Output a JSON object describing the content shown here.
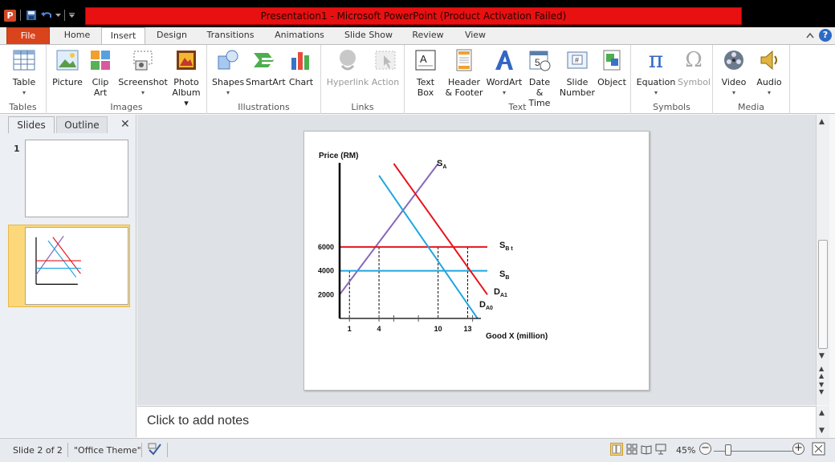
{
  "window": {
    "title": "Presentation1  -  Microsoft PowerPoint (Product Activation Failed)",
    "app_icon_letter": "P"
  },
  "tabs": [
    "File",
    "Home",
    "Insert",
    "Design",
    "Transitions",
    "Animations",
    "Slide Show",
    "Review",
    "View"
  ],
  "active_tab": "Insert",
  "ribbon": {
    "groups": {
      "tables": "Tables",
      "images": "Images",
      "illustrations": "Illustrations",
      "links": "Links",
      "text": "Text",
      "symbols": "Symbols",
      "media": "Media"
    },
    "buttons": {
      "table": "Table",
      "picture": "Picture",
      "clip_art_1": "Clip",
      "clip_art_2": "Art",
      "screenshot": "Screenshot",
      "photo_album_1": "Photo",
      "photo_album_2": "Album",
      "shapes": "Shapes",
      "smartart": "SmartArt",
      "chart": "Chart",
      "hyperlink": "Hyperlink",
      "action": "Action",
      "text_box_1": "Text",
      "text_box_2": "Box",
      "header_footer_1": "Header",
      "header_footer_2": "& Footer",
      "wordart": "WordArt",
      "date_time_1": "Date",
      "date_time_2": "& Time",
      "slide_number_1": "Slide",
      "slide_number_2": "Number",
      "object": "Object",
      "equation": "Equation",
      "symbol": "Symbol",
      "video": "Video",
      "audio": "Audio"
    }
  },
  "slides_panel": {
    "tab_slides": "Slides",
    "tab_outline": "Outline",
    "close": "✕",
    "slide_numbers": [
      "1",
      "2"
    ]
  },
  "chart": {
    "y_axis_label": "Price (RM)",
    "x_axis_label": "Good X (million)",
    "y_ticks": [
      "6000",
      "4000",
      "2000"
    ],
    "x_ticks": [
      "1",
      "4",
      "10",
      "13"
    ],
    "curve_labels": {
      "sa_main": "S",
      "sa_sub": "A",
      "sbt_main": "S",
      "sbt_sub": "B t",
      "sb_main": "S",
      "sb_sub": "B",
      "da1_main": "D",
      "da1_sub": "A1",
      "da0_main": "D",
      "da0_sub": "A0"
    },
    "colors": {
      "supply_a": "#8866bb",
      "supply_bt": "#e8141c",
      "supply_b": "#1fa6e0",
      "demand_a1": "#e8141c",
      "demand_a0": "#1fa6e0"
    }
  },
  "chart_data": {
    "type": "line",
    "title": "",
    "xlabel": "Good X (million)",
    "ylabel": "Price (RM)",
    "x_ticks": [
      1,
      4,
      10,
      13
    ],
    "y_ticks": [
      2000,
      4000,
      6000
    ],
    "series": [
      {
        "name": "SA",
        "x": [
          0,
          10
        ],
        "y": [
          2000,
          13000
        ]
      },
      {
        "name": "SB t",
        "x": [
          0,
          15
        ],
        "y": [
          6000,
          6000
        ]
      },
      {
        "name": "SB",
        "x": [
          0,
          15
        ],
        "y": [
          4000,
          4000
        ]
      },
      {
        "name": "DA1",
        "x": [
          5.5,
          15
        ],
        "y": [
          13000,
          2000
        ]
      },
      {
        "name": "DA0",
        "x": [
          4,
          14
        ],
        "y": [
          12000,
          0
        ]
      }
    ],
    "dashed_guides": [
      {
        "x": 1,
        "y": 4000
      },
      {
        "x": 4,
        "y": 6000
      },
      {
        "x": 10,
        "y": 6000
      },
      {
        "x": 13,
        "y": 6000
      }
    ]
  },
  "notes": {
    "placeholder": "Click to add notes"
  },
  "status_bar": {
    "slide_info": "Slide 2 of 2",
    "theme": "\"Office Theme\"",
    "zoom": "45%",
    "zoom_minus": "−",
    "zoom_plus": "+"
  }
}
